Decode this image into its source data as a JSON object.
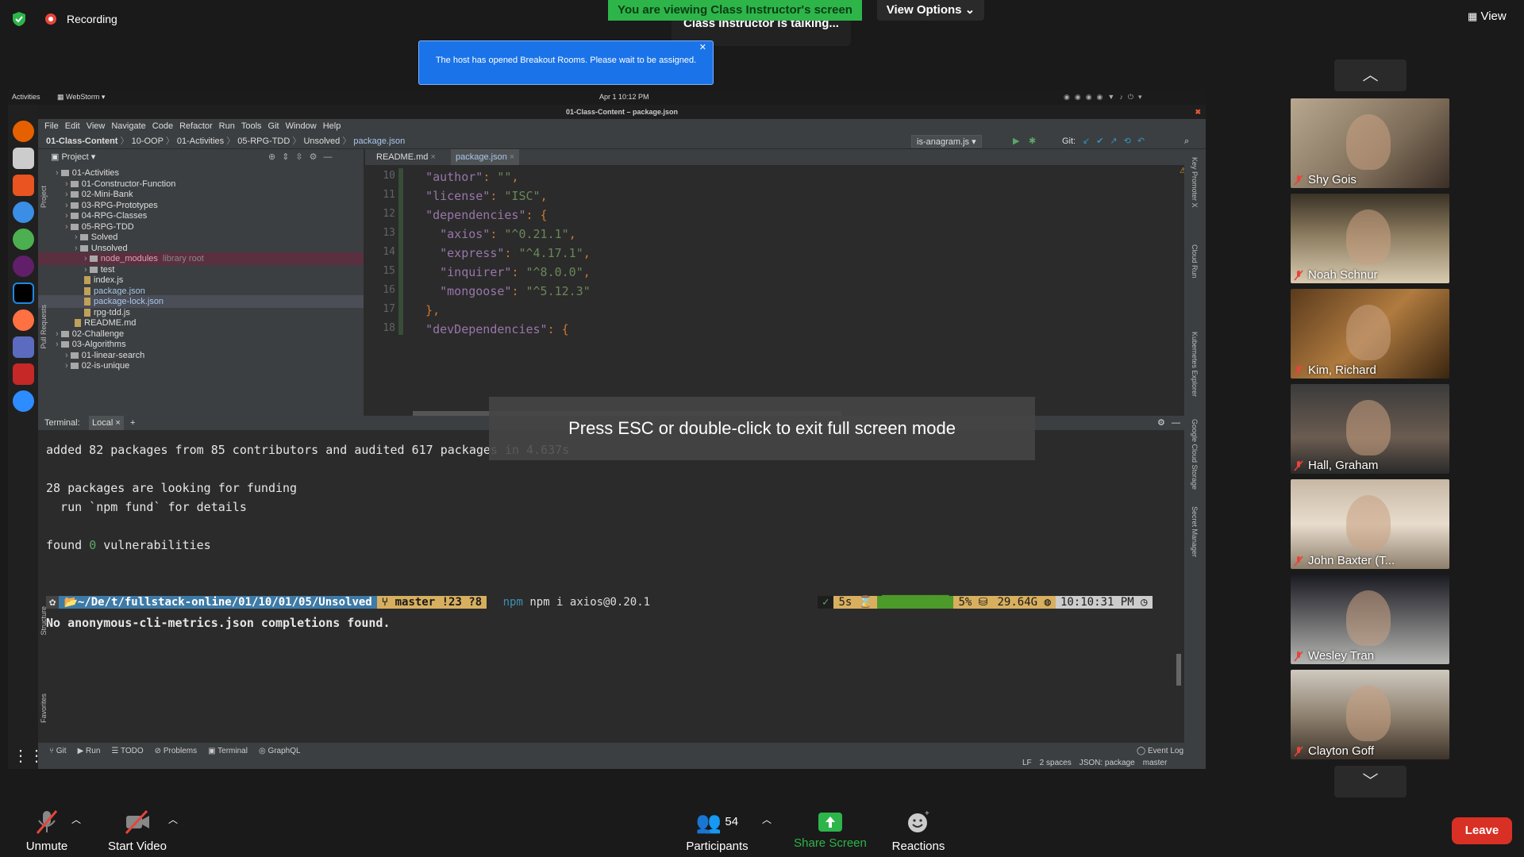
{
  "zoom": {
    "recording_label": "Recording",
    "banner": "You are viewing Class Instructor's screen",
    "talking": "Class Instructor is talking...",
    "view_options": "View Options",
    "view_label": "View",
    "notification": "The host has opened Breakout Rooms. Please wait to be assigned.",
    "fullscreen_hint": "Press ESC or double-click to exit full screen mode",
    "participants": [
      {
        "name": "Shy Gois"
      },
      {
        "name": "Noah Schnur"
      },
      {
        "name": "Kim, Richard"
      },
      {
        "name": "Hall, Graham"
      },
      {
        "name": "John Baxter (T..."
      },
      {
        "name": "Wesley Tran"
      },
      {
        "name": "Clayton Goff"
      }
    ],
    "bottom": {
      "unmute": "Unmute",
      "start_video": "Start Video",
      "participants": "Participants",
      "participants_count": "54",
      "share_screen": "Share Screen",
      "reactions": "Reactions",
      "leave": "Leave"
    }
  },
  "desktop": {
    "activities": "Activities",
    "app_name": "WebStorm",
    "clock": "Apr 1  10:12 PM"
  },
  "ide": {
    "window_title": "01-Class-Content – package.json",
    "menu": [
      "File",
      "Edit",
      "View",
      "Navigate",
      "Code",
      "Refactor",
      "Run",
      "Tools",
      "Git",
      "Window",
      "Help"
    ],
    "breadcrumb": [
      "01-Class-Content",
      "10-OOP",
      "01-Activities",
      "05-RPG-TDD",
      "Unsolved",
      "package.json"
    ],
    "run_config": "is-anagram.js",
    "git_label": "Git:",
    "project_title": "Project",
    "tree": [
      {
        "label": "01-Activities"
      },
      {
        "label": "01-Constructor-Function"
      },
      {
        "label": "02-Mini-Bank"
      },
      {
        "label": "03-RPG-Prototypes"
      },
      {
        "label": "04-RPG-Classes"
      },
      {
        "label": "05-RPG-TDD"
      },
      {
        "label": "Solved"
      },
      {
        "label": "Unsolved"
      },
      {
        "label": "node_modules",
        "note": "library root"
      },
      {
        "label": "test"
      },
      {
        "label": "index.js"
      },
      {
        "label": "package.json"
      },
      {
        "label": "package-lock.json"
      },
      {
        "label": "rpg-tdd.js"
      },
      {
        "label": "README.md"
      },
      {
        "label": "02-Challenge"
      },
      {
        "label": "03-Algorithms"
      },
      {
        "label": "01-linear-search"
      },
      {
        "label": "02-is-unique"
      }
    ],
    "editor_tabs": [
      "README.md",
      "package.json"
    ],
    "warning_count": "1",
    "code": [
      {
        "n": "10",
        "text": "  \"author\": \"\","
      },
      {
        "n": "11",
        "text": "  \"license\": \"ISC\","
      },
      {
        "n": "12",
        "text": "  \"dependencies\": {"
      },
      {
        "n": "13",
        "text": "    \"axios\": \"^0.21.1\","
      },
      {
        "n": "14",
        "text": "    \"express\": \"^4.17.1\","
      },
      {
        "n": "15",
        "text": "    \"inquirer\": \"^8.0.0\","
      },
      {
        "n": "16",
        "text": "    \"mongoose\": \"^5.12.3\""
      },
      {
        "n": "17",
        "text": "  },"
      },
      {
        "n": "18",
        "text": "  \"devDependencies\": {"
      }
    ],
    "terminal": {
      "label": "Terminal:",
      "tab": "Local",
      "lines": [
        "added 82 packages from 85 contributors and audited 617 packages in 4.637s",
        "28 packages are looking for funding",
        "  run `npm fund` for details",
        "found 0 vulnerabilities"
      ],
      "prompt_path": "~/De/t/fullstack-online/01/10/01/05/Unsolved",
      "prompt_git": "master !23 ?8",
      "command": "npm i axios@0.20.1",
      "status_ok": "✓",
      "status_time": "5s",
      "status_cpu": "5%",
      "status_mem": "29.64G",
      "status_clock": "10:10:31 PM",
      "last_line": "No anonymous-cli-metrics.json completions found."
    },
    "bottom_tabs": [
      "Git",
      "Run",
      "TODO",
      "Problems",
      "Terminal",
      "GraphQL"
    ],
    "event_log": "Event Log",
    "status_items": [
      "LF",
      "2 spaces",
      "JSON: package",
      "master"
    ],
    "side_left": [
      "Project",
      "Pull Requests",
      "Structure",
      "Favorites"
    ],
    "side_right": [
      "Key Promoter X",
      "Cloud Run",
      "Kubernetes Explorer",
      "Google Cloud Storage",
      "Secret Manager"
    ]
  }
}
